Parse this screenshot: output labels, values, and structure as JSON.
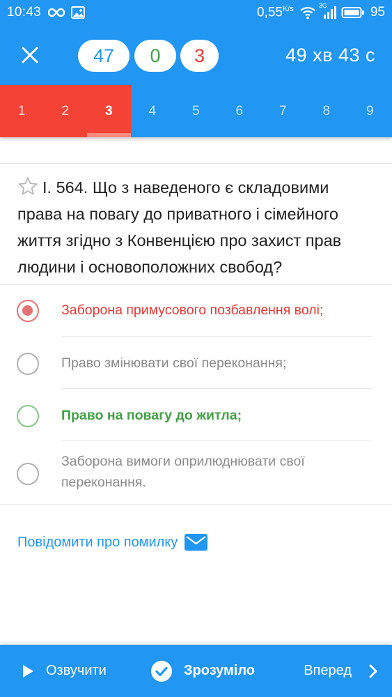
{
  "status_bar": {
    "time": "10:43",
    "speed": "0,55",
    "speed_unit": "K/s",
    "battery": "95",
    "network": "3G"
  },
  "header": {
    "counts": {
      "total": "47",
      "correct": "0",
      "wrong": "3"
    },
    "timer": "49 хв 43 с"
  },
  "tabs": [
    {
      "label": "1",
      "state": "answered"
    },
    {
      "label": "2",
      "state": "answered"
    },
    {
      "label": "3",
      "state": "active"
    },
    {
      "label": "4",
      "state": ""
    },
    {
      "label": "5",
      "state": ""
    },
    {
      "label": "6",
      "state": ""
    },
    {
      "label": "7",
      "state": ""
    },
    {
      "label": "8",
      "state": ""
    },
    {
      "label": "9",
      "state": ""
    }
  ],
  "question": {
    "text": "І. 564. Що з наведеного є складовими права на повагу до приватного і сімейного життя згідно з Конвенцією про захист прав людини і основоположних свобод?"
  },
  "options": [
    {
      "text": "Заборона примусового позбавлення волі;",
      "state": "selected-wrong"
    },
    {
      "text": "Право змінювати свої переконання;",
      "state": ""
    },
    {
      "text": "Право на повагу до житла;",
      "state": "correct"
    },
    {
      "text": "Заборона вимоги оприлюднювати свої переконання.",
      "state": ""
    }
  ],
  "report": {
    "label": "Повідомити про помилку"
  },
  "bottom_bar": {
    "speak_label": "Озвучити",
    "ok_label": "Зрозуміло",
    "next_label": "Вперед"
  },
  "colors": {
    "primary": "#2196f3",
    "answered_tab": "#f44336",
    "wrong": "#e53935",
    "correct": "#43a047"
  }
}
